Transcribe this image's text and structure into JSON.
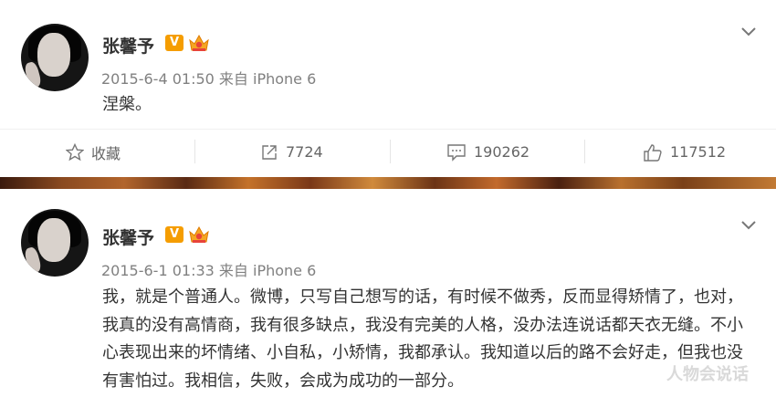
{
  "posts": [
    {
      "author": "张馨予",
      "verified_badge": "V",
      "timestamp": "2015-6-4 01:50",
      "source": "来自 iPhone 6",
      "text": "涅槃。",
      "actions": {
        "favorite_label": "收藏",
        "repost_count": "7724",
        "comment_count": "190262",
        "like_count": "117512"
      }
    },
    {
      "author": "张馨予",
      "verified_badge": "V",
      "timestamp": "2015-6-1 01:33",
      "source": "来自 iPhone 6",
      "text": "我，就是个普通人。微博，只写自己想写的话，有时候不做秀，反而显得矫情了，也对，我真的没有高情商，我有很多缺点，我没有完美的人格，没办法连说话都天衣无缝。不小心表现出来的坏情绪、小自私，小矫情，我都承认。我知道以后的路不会好走，但我也没有害怕过。我相信，失败，会成为成功的一部分。"
    }
  ],
  "watermark": "人物会说话",
  "colors": {
    "verified": "#f59d00",
    "text": "#333333",
    "meta": "#808080",
    "action": "#666666"
  },
  "icons": [
    "chevron-down-icon",
    "star-icon",
    "repost-icon",
    "comment-icon",
    "like-icon",
    "crown-badge-icon"
  ]
}
